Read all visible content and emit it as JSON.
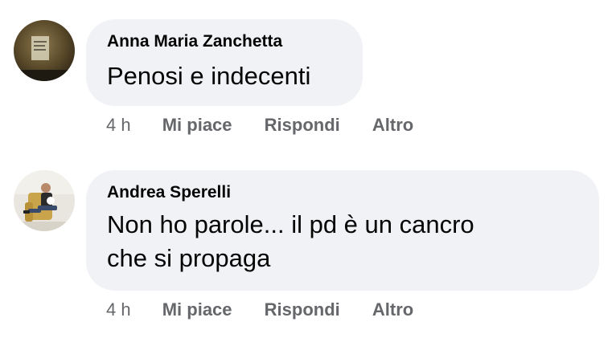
{
  "comments": [
    {
      "author": "Anna Maria Zanchetta",
      "text": "Penosi e indecenti",
      "time": "4 h",
      "like_label": "Mi piace",
      "reply_label": "Rispondi",
      "more_label": "Altro"
    },
    {
      "author": "Andrea Sperelli",
      "text_line1": "Non ho parole... il pd è un cancro",
      "text_line2": "che si propaga",
      "time": "4 h",
      "like_label": "Mi piace",
      "reply_label": "Rispondi",
      "more_label": "Altro"
    }
  ],
  "colors": {
    "bubble": "#f0f2f5",
    "meta_text": "#65676b",
    "body_text": "#050505"
  }
}
